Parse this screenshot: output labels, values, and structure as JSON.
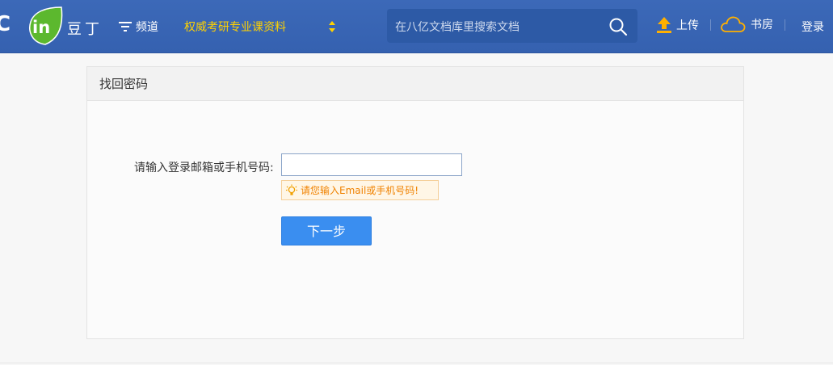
{
  "header": {
    "logo_letters": "C",
    "logo_leaf_text": "in",
    "logo_cn": "豆丁",
    "channel_label": "频道",
    "promo_label": "权威考研专业课资料",
    "search_placeholder": "在八亿文档库里搜索文档",
    "upload_label": "上传",
    "bookroom_label": "书房",
    "login_label": "登录"
  },
  "panel": {
    "title": "找回密码",
    "field_label": "请输入登录邮箱或手机号码:",
    "field_value": "",
    "hint_text": "请您输入Email或手机号码!",
    "next_button": "下一步"
  },
  "colors": {
    "header_bg": "#3561b0",
    "promo": "#ffd200",
    "button": "#3a8ef0",
    "hint_text": "#f08200"
  },
  "icons": [
    "filter-icon",
    "sort-arrows-icon",
    "search-icon",
    "upload-icon",
    "cloud-icon",
    "lightbulb-icon"
  ]
}
